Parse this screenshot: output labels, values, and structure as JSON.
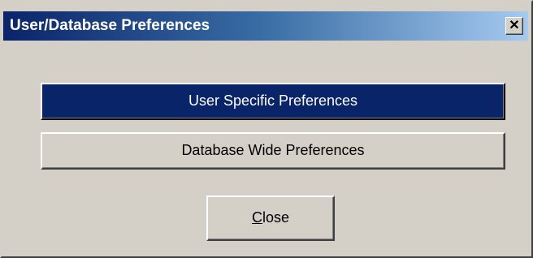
{
  "window": {
    "title": "User/Database Preferences",
    "close_glyph": "×",
    "close_icon": "close-icon"
  },
  "buttons": {
    "user_specific": "User Specific Preferences",
    "database_wide": "Database Wide Preferences",
    "close_mnemonic": "C",
    "close_rest": "lose"
  },
  "colors": {
    "titlebar_start": "#0a246a",
    "titlebar_end": "#a6caf0",
    "selected_button": "#0a246a",
    "dialog_face": "#d4d0c8"
  }
}
